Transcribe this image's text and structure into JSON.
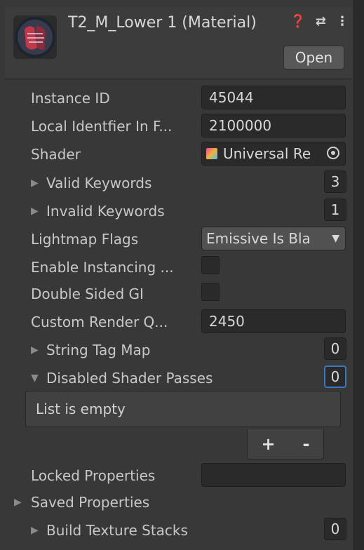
{
  "header": {
    "title": "T2_M_Lower 1 (Material)",
    "open_label": "Open",
    "icons": [
      "help-icon",
      "preset-icon",
      "more-menu-icon"
    ]
  },
  "properties": {
    "instance_id": {
      "label": "Instance ID",
      "value": "45044"
    },
    "local_identifier": {
      "label": "Local Identfier In F...",
      "value": "2100000"
    },
    "shader": {
      "label": "Shader",
      "value": "Universal Re"
    },
    "valid_keywords": {
      "label": "Valid Keywords",
      "count": "3"
    },
    "invalid_keywords": {
      "label": "Invalid Keywords",
      "count": "1"
    },
    "lightmap_flags": {
      "label": "Lightmap Flags",
      "value": "Emissive Is Bla"
    },
    "enable_instancing": {
      "label": "Enable Instancing ..."
    },
    "double_sided_gi": {
      "label": "Double Sided GI"
    },
    "custom_render_queue": {
      "label": "Custom Render Q...",
      "value": "2450"
    },
    "string_tag_map": {
      "label": "String Tag Map",
      "count": "0"
    },
    "disabled_shader_passes": {
      "label": "Disabled Shader Passes",
      "count": "0",
      "empty_text": "List is empty"
    },
    "locked_properties": {
      "label": "Locked Properties"
    },
    "saved_properties": {
      "label": "Saved Properties"
    },
    "build_texture_stacks": {
      "label": "Build Texture Stacks",
      "count": "0"
    }
  },
  "list_controls": {
    "add": "+",
    "remove": "-"
  },
  "colors": {
    "background": "#383838",
    "field": "#2a2a2a",
    "accent": "#3a79bb"
  }
}
